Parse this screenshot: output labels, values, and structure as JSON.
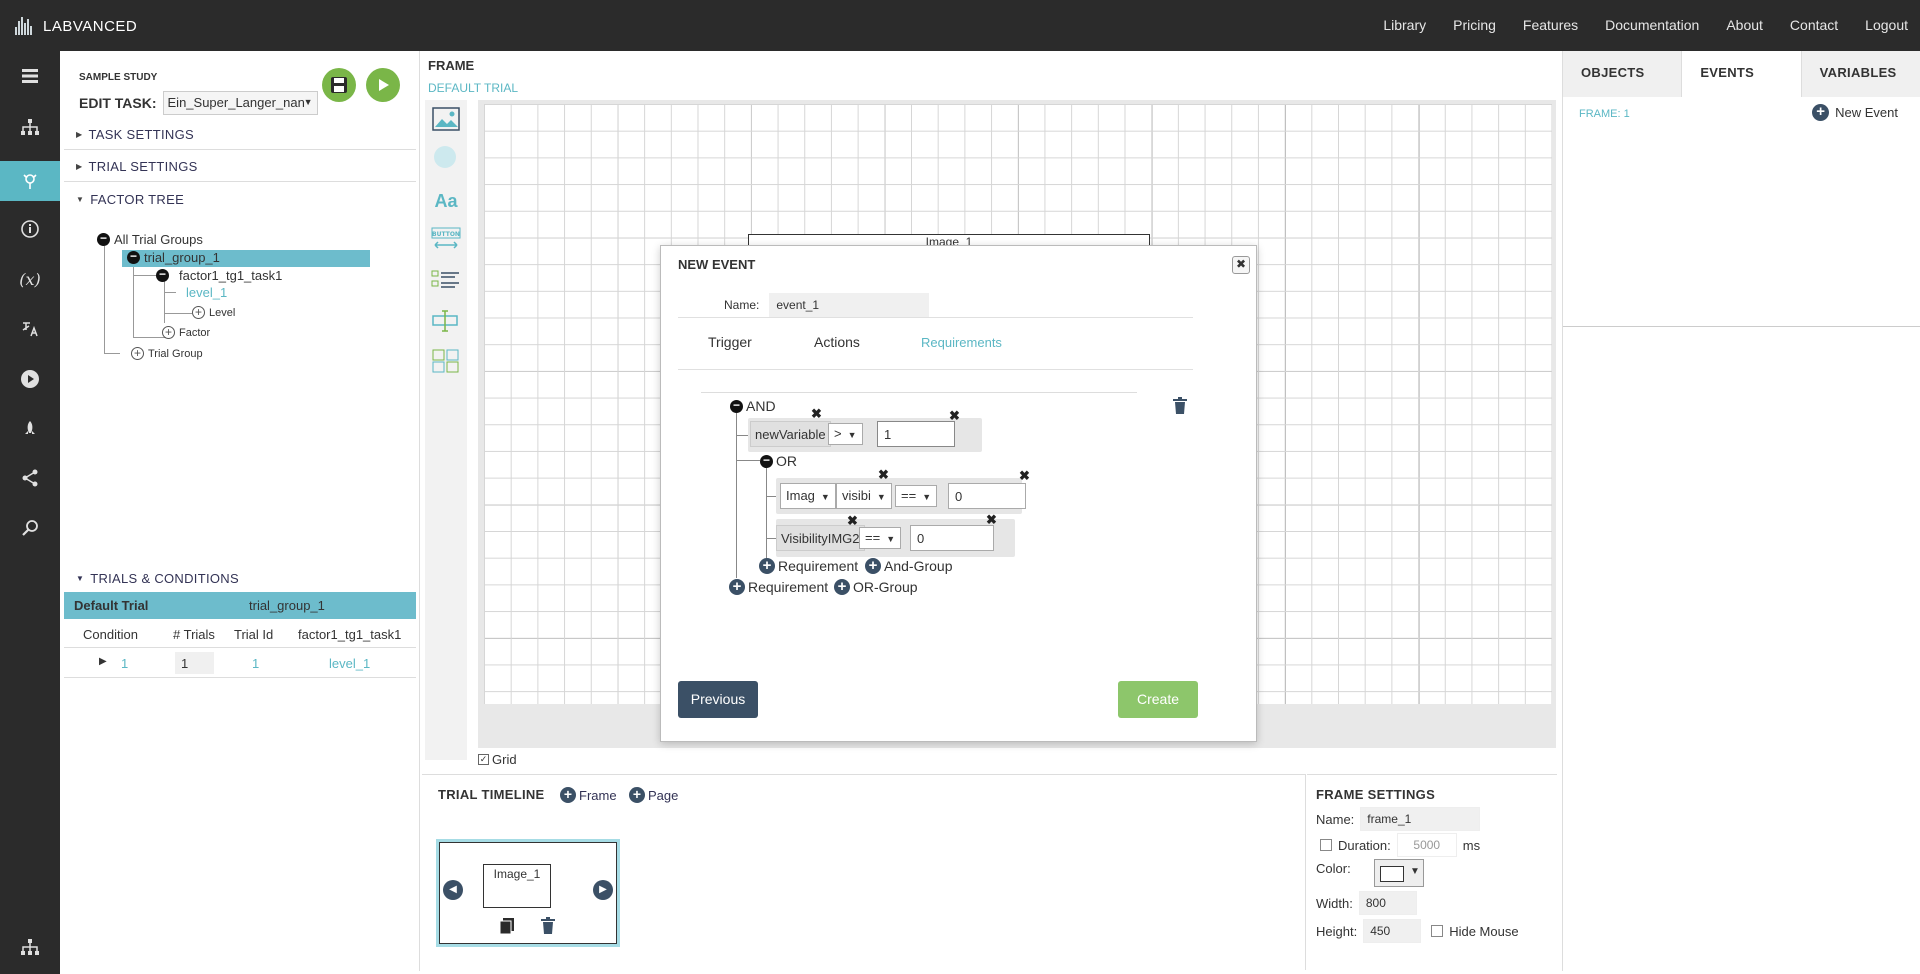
{
  "topbar": {
    "logo": "LABVANCED",
    "nav": [
      "Library",
      "Pricing",
      "Features",
      "Documentation",
      "About",
      "Contact",
      "Logout"
    ]
  },
  "leftbar": {
    "icons": [
      "list-icon",
      "sitemap-icon",
      "editor-icon",
      "info-icon",
      "variables-icon",
      "translate-icon",
      "play-icon",
      "rocket-icon",
      "share-icon",
      "search-icon"
    ],
    "bottom_icon": "sitemap-icon"
  },
  "task": {
    "study_label": "SAMPLE STUDY",
    "edit_label": "EDIT TASK:",
    "task_name": "Ein_Super_Langer_nan"
  },
  "sections": {
    "task_settings": "TASK SETTINGS",
    "trial_settings": "TRIAL SETTINGS",
    "factor_tree": "FACTOR TREE",
    "trials_conditions": "TRIALS & CONDITIONS"
  },
  "factor_tree": {
    "root": "All Trial Groups",
    "group": "trial_group_1",
    "factor": "factor1_tg1_task1",
    "level": "level_1",
    "add_level": "Level",
    "add_factor": "Factor",
    "add_trial_group": "Trial Group"
  },
  "trials": {
    "default_label": "Default Trial",
    "default_group": "trial_group_1",
    "columns": [
      "Condition",
      "# Trials",
      "Trial Id",
      "factor1_tg1_task1"
    ],
    "row": {
      "condition": "1",
      "num_trials": "1",
      "trial_id": "1",
      "level": "level_1"
    }
  },
  "frame": {
    "header": "FRAME",
    "sub": "DEFAULT TRIAL",
    "image_label": "Image_1",
    "grid_label": "Grid",
    "grid_checked": true
  },
  "tools": [
    "image-tool-icon",
    "shape-tool-icon",
    "text-tool-icon",
    "button-tool-icon",
    "list-tool-icon",
    "input-tool-icon",
    "layout-tool-icon"
  ],
  "right_panel": {
    "tabs": [
      "OBJECTS",
      "EVENTS",
      "VARIABLES"
    ],
    "active_tab": "EVENTS",
    "frame_label": "FRAME: 1",
    "new_event": "New Event"
  },
  "timeline": {
    "title": "TRIAL TIMELINE",
    "add_frame": "Frame",
    "add_page": "Page",
    "thumb_label": "Image_1"
  },
  "frame_settings": {
    "title": "FRAME SETTINGS",
    "name_label": "Name:",
    "name_value": "frame_1",
    "duration_label": "Duration:",
    "duration_value": "5000",
    "duration_unit": "ms",
    "color_label": "Color:",
    "width_label": "Width:",
    "width_value": "800",
    "height_label": "Height:",
    "height_value": "450",
    "hide_mouse": "Hide Mouse"
  },
  "modal": {
    "title": "NEW EVENT",
    "name_label": "Name:",
    "name_value": "event_1",
    "tabs": [
      "Trigger",
      "Actions",
      "Requirements"
    ],
    "active_tab": "Requirements",
    "and_label": "AND",
    "or_label": "OR",
    "req1": {
      "variable": "newVariable",
      "operator": ">",
      "value": "1"
    },
    "req2": {
      "object": "Imag",
      "property": "visibi",
      "operator": "==",
      "value": "0"
    },
    "req3": {
      "variable": "VisibilityIMG2",
      "operator": "==",
      "value": "0"
    },
    "add_requirement": "Requirement",
    "add_and_group": "And-Group",
    "add_or_group": "OR-Group",
    "prev_btn": "Previous",
    "create_btn": "Create"
  },
  "colors": {
    "accent": "#5bb7c4",
    "dark": "#2b2b2b",
    "button_dark": "#3b5066",
    "green": "#8dc66b"
  }
}
